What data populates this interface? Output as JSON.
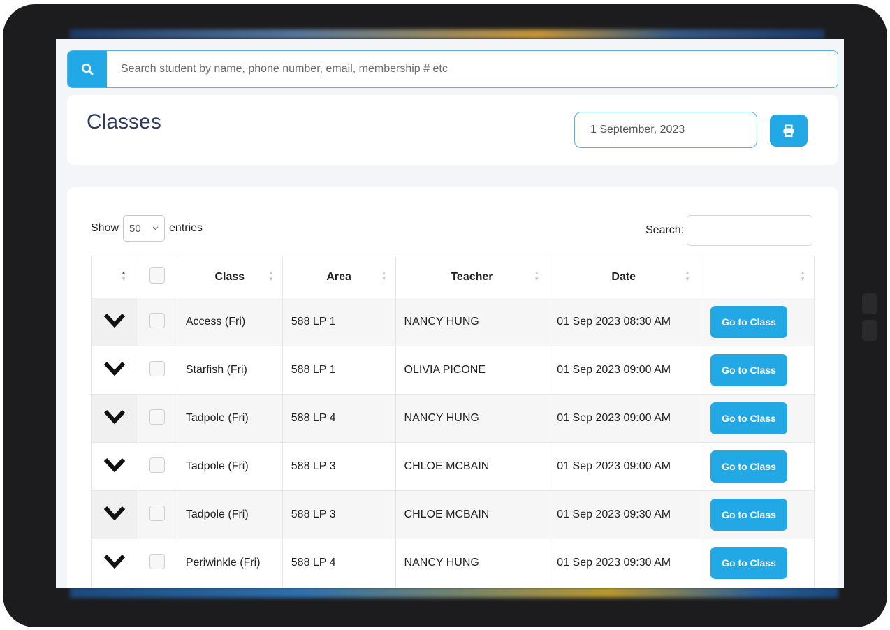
{
  "search": {
    "placeholder": "Search student by name, phone number, email, membership # etc"
  },
  "header": {
    "title": "Classes",
    "date_value": "1 September, 2023"
  },
  "table_controls": {
    "show_label": "Show",
    "entries_value": "50",
    "entries_label": "entries",
    "search_label": "Search:"
  },
  "columns": [
    "Class",
    "Area",
    "Teacher",
    "Date"
  ],
  "action_label": "Go to Class",
  "rows": [
    {
      "class": "Access (Fri)",
      "area": "588 LP 1",
      "teacher": "NANCY HUNG",
      "date": "01 Sep 2023 08:30 AM"
    },
    {
      "class": "Starfish (Fri)",
      "area": "588 LP 1",
      "teacher": "OLIVIA PICONE",
      "date": "01 Sep 2023 09:00 AM"
    },
    {
      "class": "Tadpole (Fri)",
      "area": "588 LP 4",
      "teacher": "NANCY HUNG",
      "date": "01 Sep 2023 09:00 AM"
    },
    {
      "class": "Tadpole (Fri)",
      "area": "588 LP 3",
      "teacher": "CHLOE MCBAIN",
      "date": "01 Sep 2023 09:00 AM"
    },
    {
      "class": "Tadpole (Fri)",
      "area": "588 LP 3",
      "teacher": "CHLOE MCBAIN",
      "date": "01 Sep 2023 09:30 AM"
    },
    {
      "class": "Periwinkle (Fri)",
      "area": "588 LP 4",
      "teacher": "NANCY HUNG",
      "date": "01 Sep 2023 09:30 AM"
    }
  ],
  "colors": {
    "accent": "#23a8e6",
    "title": "#2d3b63"
  },
  "icons": {
    "search": "search-icon",
    "print": "print-icon",
    "expand": "chevron-down-icon"
  }
}
